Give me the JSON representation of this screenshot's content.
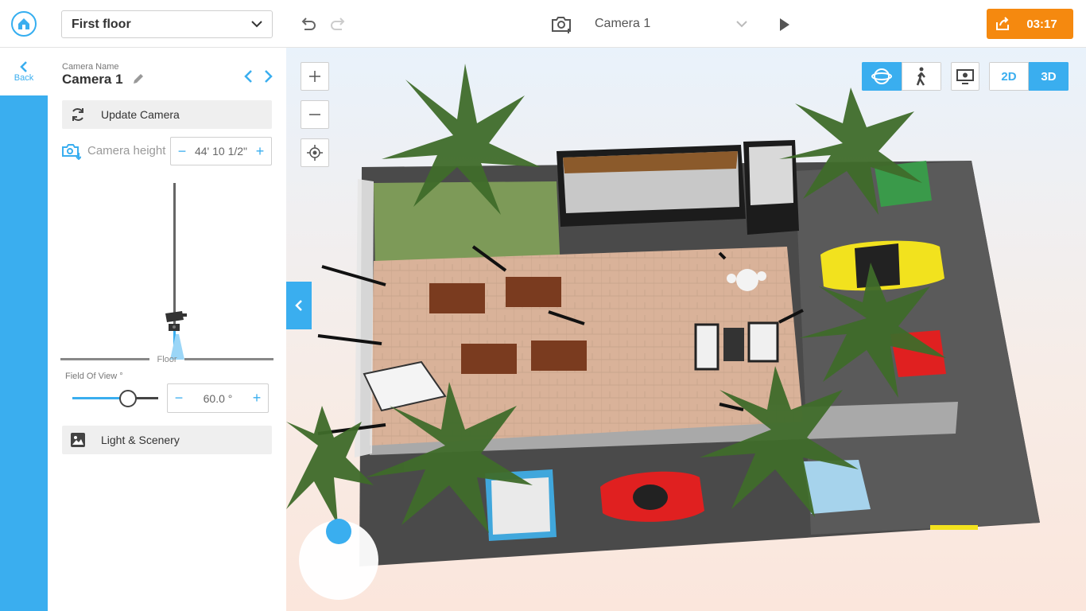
{
  "floor_selector": {
    "value": "First floor"
  },
  "camera_selector": {
    "value": "Camera 1"
  },
  "timer": {
    "label": "03:17"
  },
  "back": {
    "label": "Back"
  },
  "panel": {
    "camera_name_label": "Camera Name",
    "camera_name": "Camera 1",
    "update_camera_label": "Update Camera",
    "camera_height_label": "Camera height",
    "camera_height_value": "44' 10 1/2\"",
    "floor_label": "Floor",
    "fov_label": "Field Of View °",
    "fov_value": "60.0 °",
    "fov_level": 0.65,
    "light_scenery_label": "Light & Scenery"
  },
  "view_mode": {
    "options": [
      "2D",
      "3D"
    ],
    "selected": "3D"
  },
  "colors": {
    "accent": "#3aaeef",
    "timer": "#f5890f"
  }
}
